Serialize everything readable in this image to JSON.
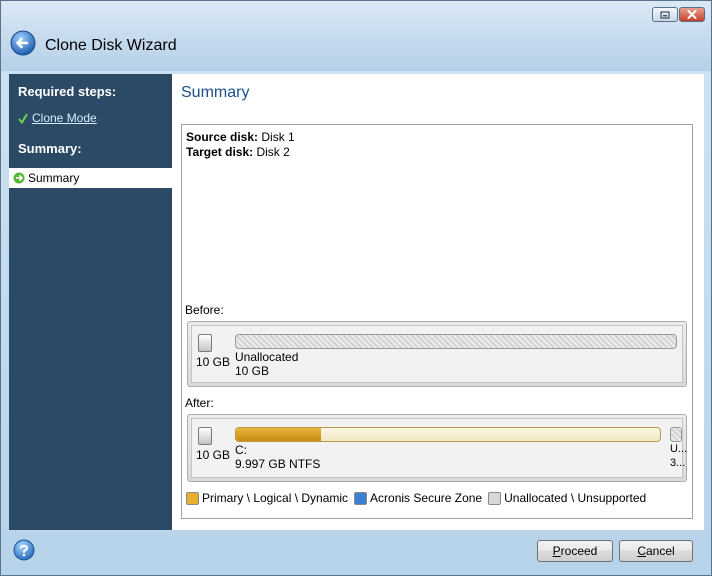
{
  "window": {
    "title": "Clone Disk Wizard"
  },
  "sidebar": {
    "required_heading": "Required steps:",
    "clone_mode_link": "Clone Mode",
    "summary_heading": "Summary:",
    "selected_step": "Summary"
  },
  "content": {
    "title": "Summary",
    "source_label": "Source disk:",
    "source_value": "Disk 1",
    "target_label": "Target disk:",
    "target_value": "Disk 2",
    "before_label": "Before:",
    "after_label": "After:",
    "before": {
      "disk_size": "10 GB",
      "partition_name": "Unallocated",
      "partition_size": "10 GB"
    },
    "after": {
      "disk_size": "10 GB",
      "partition_name": "C:",
      "partition_size": "9.997 GB  NTFS",
      "primary_fill_percent": 20,
      "trailing_name": "U...",
      "trailing_size": "3..."
    }
  },
  "legend": {
    "items": [
      {
        "label": "Primary \\ Logical \\ Dynamic",
        "color": "#e6b031"
      },
      {
        "label": "Acronis Secure Zone",
        "color": "#3a7fd0"
      },
      {
        "label": "Unallocated \\ Unsupported",
        "color": "#d7d7d7"
      }
    ]
  },
  "footer": {
    "proceed_hotkey": "P",
    "proceed_rest": "roceed",
    "cancel_hotkey": "C",
    "cancel_rest": "ancel"
  }
}
